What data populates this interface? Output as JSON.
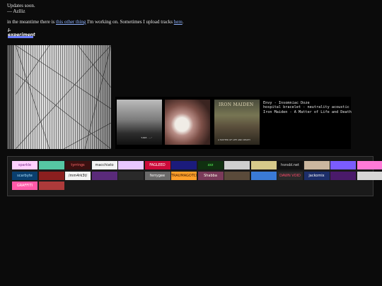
{
  "intro": {
    "line1": "Updates soon.",
    "line2": "— Azlliz",
    "line3_prefix": "in the meantime there is",
    "line3_link": "this other thing",
    "line3_middle": "I'm working on. Sometimes I upload tracks",
    "line3_link2": "here",
    "line3_suffix": "."
  },
  "logo": {
    "text": "i-experiment"
  },
  "now_playing": {
    "covers": [
      {
        "name": "cover-1"
      },
      {
        "name": "cover-2"
      },
      {
        "name": "cover-3",
        "band": "IRON MAIDEN",
        "sub": "A MATTER OF LIFE AND DEATH"
      }
    ],
    "cover1_caption": "'1993 · ....'",
    "tracks": [
      "Envy - Insomniac Doze",
      "hospital bracelet - neutrality acoustic",
      "Iron Maiden - A Matter of Life and Death"
    ]
  },
  "buttons": [
    {
      "label": "sparkle",
      "bg": "#ffd1ff",
      "fg": "#7a2a8a"
    },
    {
      "label": "",
      "bg": "#56c7a3",
      "fg": "#ffffff"
    },
    {
      "label": "tyrrings",
      "bg": "#3a1010",
      "fg": "#ff6a6a"
    },
    {
      "label": "macchiato",
      "bg": "#f4f4f4",
      "fg": "#222"
    },
    {
      "label": "",
      "bg": "#e8c7ff",
      "fg": "#5a2a7a"
    },
    {
      "label": "FAGLEED",
      "bg": "#cc0a3a",
      "fg": "#ffffff"
    },
    {
      "label": "",
      "bg": "#1b1b7c",
      "fg": "#ff77ff"
    },
    {
      "label": "zzz",
      "bg": "#103010",
      "fg": "#5cff5c"
    },
    {
      "label": "",
      "bg": "#cfcfcf",
      "fg": "#333"
    },
    {
      "label": "",
      "bg": "#d6c98a",
      "fg": "#223"
    },
    {
      "label": "hsnsbl.net",
      "bg": "#111",
      "fg": "#ddd"
    },
    {
      "label": "",
      "bg": "#cbb79f",
      "fg": "#222"
    },
    {
      "label": "",
      "bg": "#7a5cff",
      "fg": "#fff"
    },
    {
      "label": "",
      "bg": "#ff7ad7",
      "fg": "#2a0030"
    },
    {
      "label": "scarbyte",
      "bg": "#0a3f6e",
      "fg": "#aee3ff"
    },
    {
      "label": "",
      "bg": "#8b1f1f",
      "fg": "#ffcccc"
    },
    {
      "label": "/mm4rk3t/",
      "bg": "#f4f4f4",
      "fg": "#111"
    },
    {
      "label": "",
      "bg": "#5a2a7a",
      "fg": "#ffd1ff"
    },
    {
      "label": "",
      "bg": "#2a2a2a",
      "fg": "#bbb"
    },
    {
      "label": "ferrygee",
      "bg": "#6a6a6a",
      "fg": "#fff"
    },
    {
      "label": "TRAUMAGOTCHI",
      "bg": "#ff9f2a",
      "fg": "#3a1800"
    },
    {
      "label": "Shabba",
      "bg": "#7a3a5a",
      "fg": "#ffe"
    },
    {
      "label": "",
      "bg": "#5a4a3a",
      "fg": "#fff"
    },
    {
      "label": "",
      "bg": "#3a7ad7",
      "fg": "#fff"
    },
    {
      "label": "DAWN VOID",
      "bg": "#2a2a2a",
      "fg": "#ff4a6a"
    },
    {
      "label": "jackomix",
      "bg": "#1c2e6a",
      "fg": "#fff"
    },
    {
      "label": "",
      "bg": "#4a1a6a",
      "fg": "#fff"
    },
    {
      "label": "",
      "bg": "#d6d6d6",
      "fg": "#111"
    },
    {
      "label": "GRAFFITI",
      "bg": "#ff5aa8",
      "fg": "#fff"
    },
    {
      "label": "",
      "bg": "#ad3a3a",
      "fg": "#ffcf7a"
    }
  ]
}
